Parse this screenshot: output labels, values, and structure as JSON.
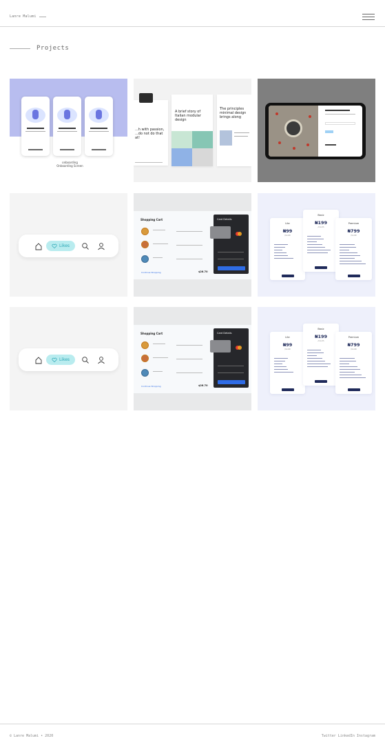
{
  "header": {
    "brand": "Lanre Malumi",
    "menu_icon": "hamburger-icon"
  },
  "section": {
    "title": "Projects"
  },
  "projects": [
    {
      "kind": "onboarding",
      "caption_1": "onboarding",
      "caption_2": "Onboarding Screen"
    },
    {
      "kind": "blog",
      "heading_1": "A brief story of Italian modular design",
      "heading_2": "The principles minimal design brings along",
      "heading_3": "...h with passion, ...do not do that at!"
    },
    {
      "kind": "compass-app"
    },
    {
      "kind": "likes-nav",
      "pill_label": "Likes"
    },
    {
      "kind": "shopping-cart",
      "title": "Shopping Cart",
      "card_title": "Card Details",
      "link": "Continue Shopping",
      "total": "$26.70"
    },
    {
      "kind": "pricing",
      "plans": [
        {
          "name": "Lite",
          "price": "₦99",
          "period": "/month"
        },
        {
          "name": "Basic",
          "price": "₦199",
          "period": "/month"
        },
        {
          "name": "Premium",
          "price": "₦799",
          "period": "/month"
        }
      ]
    },
    {
      "kind": "likes-nav",
      "pill_label": "Likes"
    },
    {
      "kind": "shopping-cart",
      "title": "Shopping Cart",
      "card_title": "Card Details",
      "link": "Continue Shopping",
      "total": "$26.70"
    },
    {
      "kind": "pricing",
      "plans": [
        {
          "name": "Lite",
          "price": "₦99",
          "period": "/month"
        },
        {
          "name": "Basic",
          "price": "₦199",
          "period": "/month"
        },
        {
          "name": "Premium",
          "price": "₦799",
          "period": "/month"
        }
      ]
    }
  ],
  "footer": {
    "copyright": "© Lanre Malumi • 2020",
    "social": "Twitter LinkedIn Instagram"
  }
}
